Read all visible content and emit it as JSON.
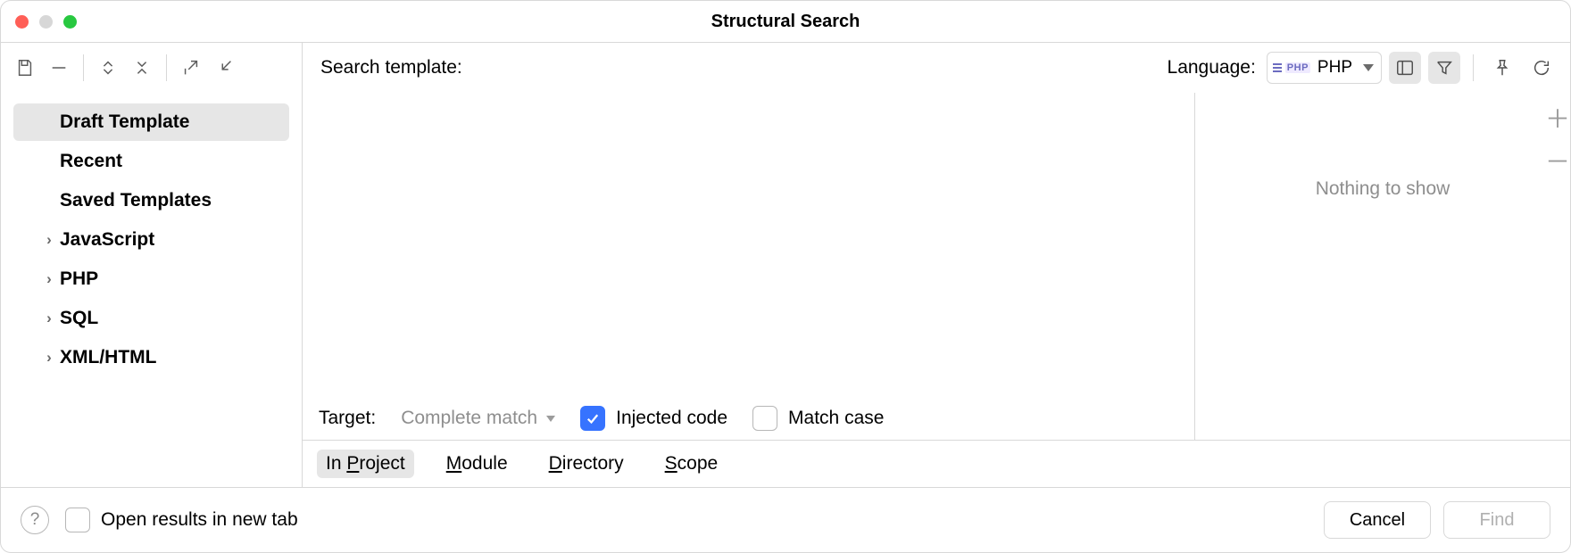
{
  "title": "Structural Search",
  "sidebar": {
    "items": [
      {
        "label": "Draft Template",
        "expandable": false,
        "selected": true
      },
      {
        "label": "Recent",
        "expandable": false,
        "selected": false
      },
      {
        "label": "Saved Templates",
        "expandable": false,
        "selected": false
      },
      {
        "label": "JavaScript",
        "expandable": true,
        "selected": false
      },
      {
        "label": "PHP",
        "expandable": true,
        "selected": false
      },
      {
        "label": "SQL",
        "expandable": true,
        "selected": false
      },
      {
        "label": "XML/HTML",
        "expandable": true,
        "selected": false
      }
    ]
  },
  "search": {
    "label": "Search template:",
    "value": "",
    "language_label": "Language:",
    "language_value": "PHP"
  },
  "target": {
    "label": "Target:",
    "value": "Complete match",
    "injected_label": "Injected code",
    "injected_checked": true,
    "match_case_label": "Match case",
    "match_case_checked": false
  },
  "filters": {
    "placeholder": "Nothing to show"
  },
  "scope": {
    "tabs": [
      {
        "label": "In Project",
        "mnemonic": "P",
        "active": true
      },
      {
        "label": "Module",
        "mnemonic": "M",
        "active": false
      },
      {
        "label": "Directory",
        "mnemonic": "D",
        "active": false
      },
      {
        "label": "Scope",
        "mnemonic": "S",
        "active": false
      }
    ]
  },
  "footer": {
    "open_new_tab_label": "Open results in new tab",
    "open_new_tab_checked": false,
    "cancel": "Cancel",
    "find": "Find"
  }
}
